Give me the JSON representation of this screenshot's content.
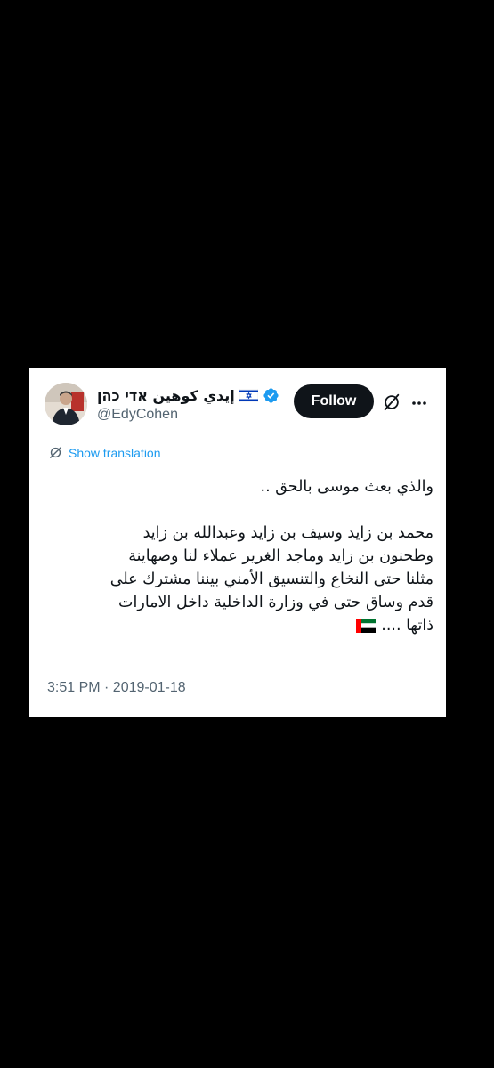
{
  "author": {
    "display_name": "إيدي كوهين אדי כהן",
    "handle": "@EdyCohen",
    "verified": true,
    "flag_icon": "israel-flag-icon",
    "avatar_icon": "user-avatar"
  },
  "actions": {
    "follow_label": "Follow",
    "grok_icon": "grok-icon",
    "more_icon": "more-options-icon"
  },
  "translation": {
    "label": "Show translation",
    "icon": "globe-icon"
  },
  "tweet": {
    "line1": "والذي بعث موسى بالحق ..",
    "line2": "محمد بن زايد وسيف بن زايد وعبدالله بن زايد",
    "line3": "وطحنون بن زايد وماجد الغرير عملاء لنا وصهاينة",
    "line4": "مثلنا حتى النخاع والتنسيق الأمني بيننا مشترك على",
    "line5": "قدم وساق حتى في وزارة الداخلية داخل الامارات",
    "line6": "ذاتها ....",
    "end_emoji": "uae-flag-icon"
  },
  "meta": {
    "timestamp": "3:51 PM · 2019-01-18"
  },
  "colors": {
    "background": "#000000",
    "card": "#ffffff",
    "text": "#0f1419",
    "secondary": "#536471",
    "link": "#1d9bf0",
    "verified": "#1d9bf0",
    "follow_bg": "#0f1419"
  }
}
